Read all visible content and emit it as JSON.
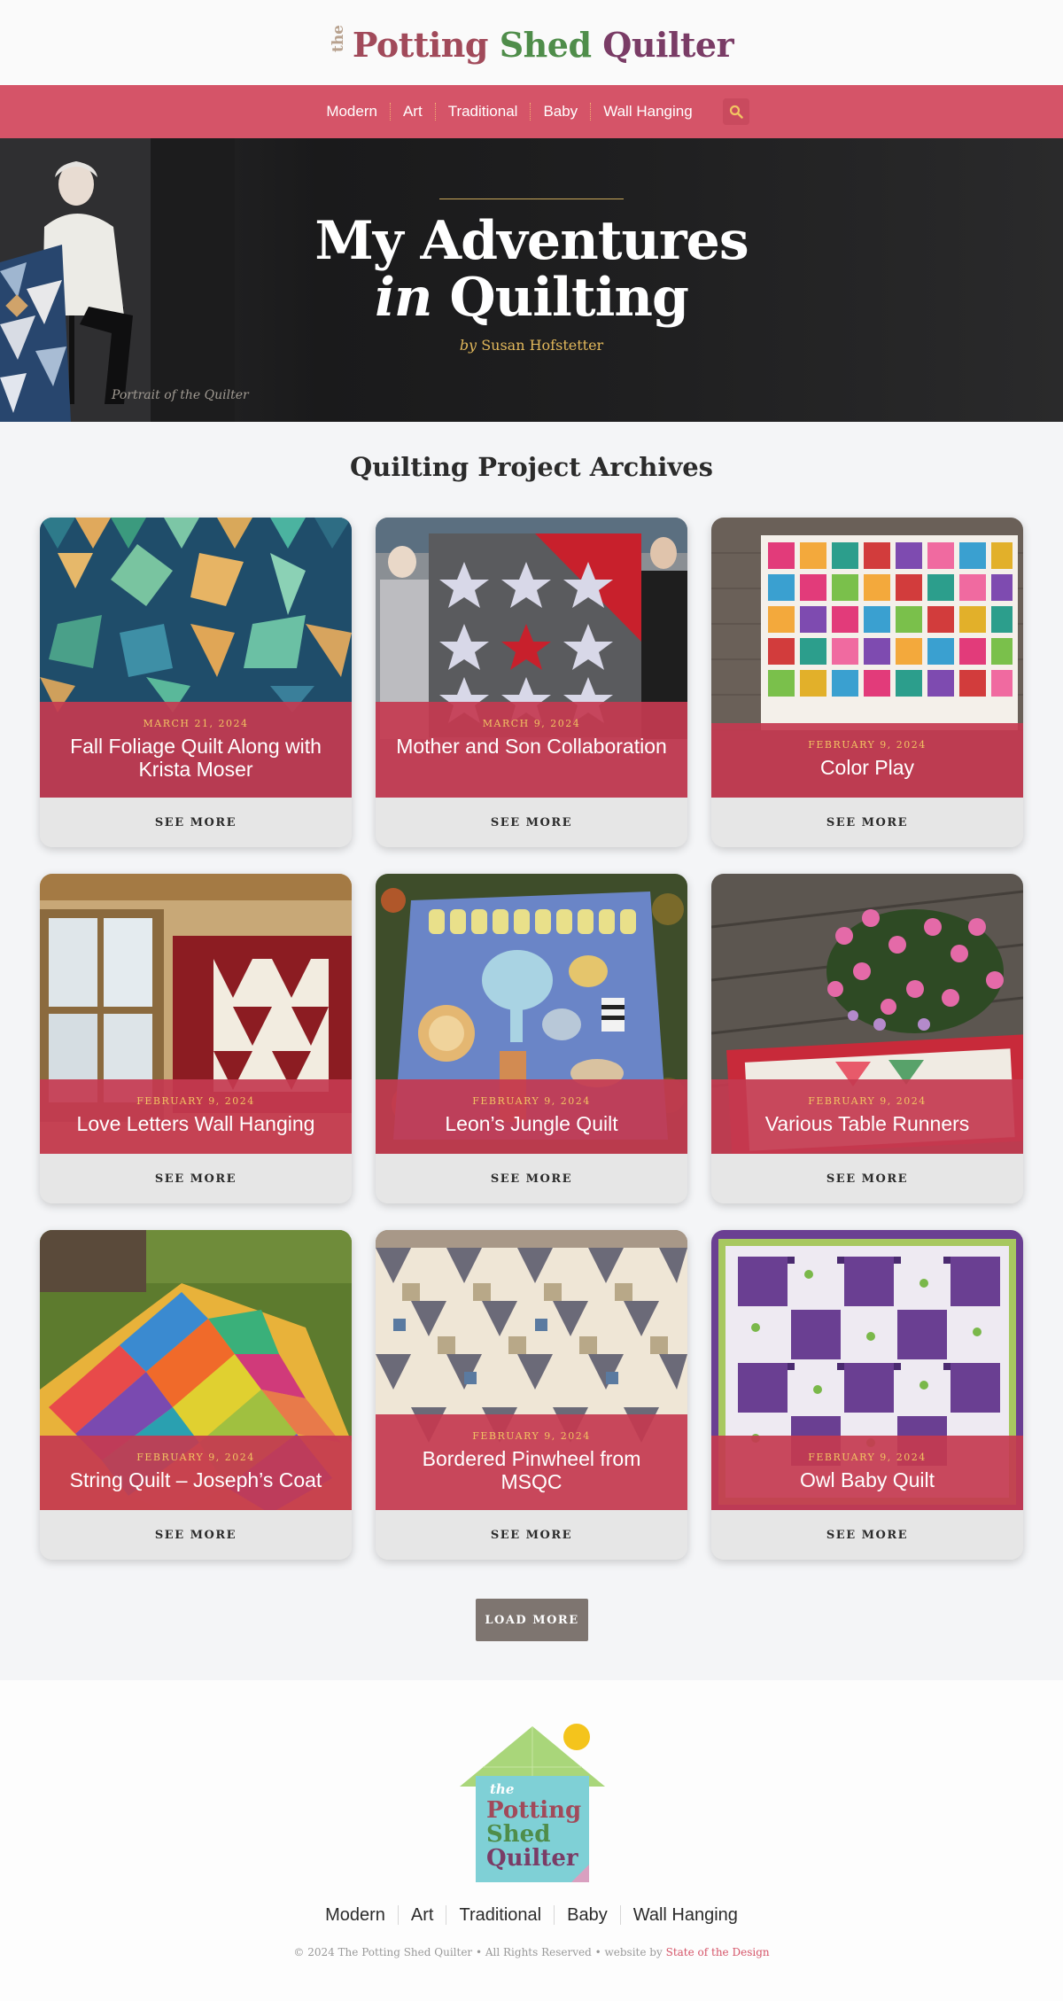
{
  "header": {
    "logo_the": "the",
    "logo_word1": "Potting",
    "logo_word2": "Shed",
    "logo_word3": "Quilter"
  },
  "nav": {
    "items": [
      "Modern",
      "Art",
      "Traditional",
      "Baby",
      "Wall Hanging"
    ],
    "search_icon": "search-icon"
  },
  "hero": {
    "title_line1": "My Adventures",
    "title_in": "in",
    "title_line2": "Quilting",
    "by": "by",
    "author": "Susan Hofstetter",
    "caption": "Portrait of the Quilter"
  },
  "archive": {
    "heading": "Quilting Project Archives",
    "see_more": "SEE MORE",
    "load_more": "LOAD MORE",
    "cards": [
      {
        "date": "MARCH 21, 2024",
        "title": "Fall Foliage Quilt Along with Krista Moser"
      },
      {
        "date": "MARCH 9, 2024",
        "title": "Mother and Son Collaboration"
      },
      {
        "date": "FEBRUARY 9, 2024",
        "title": "Color Play"
      },
      {
        "date": "FEBRUARY 9, 2024",
        "title": "Love Letters Wall Hanging"
      },
      {
        "date": "FEBRUARY 9, 2024",
        "title": "Leon’s Jungle Quilt"
      },
      {
        "date": "FEBRUARY 9, 2024",
        "title": "Various Table Runners"
      },
      {
        "date": "FEBRUARY 9, 2024",
        "title": "String Quilt – Joseph’s Coat"
      },
      {
        "date": "FEBRUARY 9, 2024",
        "title": "Bordered Pinwheel from MSQC"
      },
      {
        "date": "FEBRUARY 9, 2024",
        "title": "Owl Baby Quilt"
      }
    ]
  },
  "footer": {
    "logo_the": "the",
    "logo_word1": "Potting",
    "logo_word2": "Shed",
    "logo_word3": "Quilter",
    "nav_items": [
      "Modern",
      "Art",
      "Traditional",
      "Baby",
      "Wall Hanging"
    ],
    "copyright": "© 2024 The Potting Shed Quilter • All Rights Reserved • website by",
    "credit": "State of the Design"
  },
  "colors": {
    "brand_pink": "#d55468",
    "gold": "#e2b85b",
    "hero_bg": "#1f1f20"
  }
}
